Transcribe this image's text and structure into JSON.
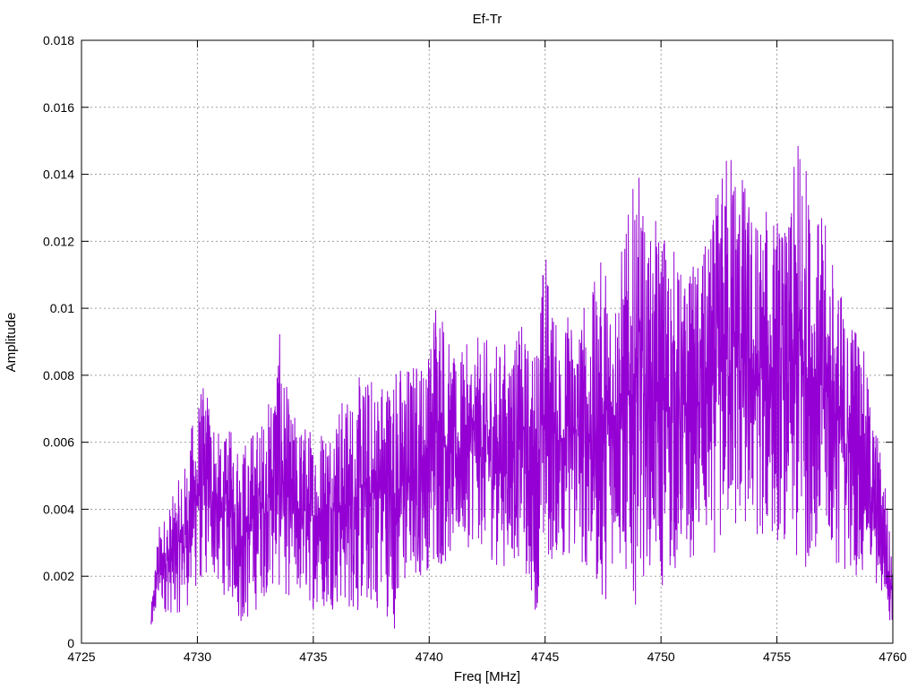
{
  "chart_data": {
    "type": "line",
    "title": "Ef-Tr",
    "xlabel": "Freq [MHz]",
    "ylabel": "Amplitude",
    "xlim": [
      4725,
      4760
    ],
    "ylim": [
      0,
      0.018
    ],
    "x_ticks": [
      4725,
      4730,
      4735,
      4740,
      4745,
      4750,
      4755,
      4760
    ],
    "x_tick_labels": [
      "4725",
      "4730",
      "4735",
      "4740",
      "4745",
      "4750",
      "4755",
      "4760"
    ],
    "y_ticks": [
      0,
      0.002,
      0.004,
      0.006,
      0.008,
      0.01,
      0.012,
      0.014,
      0.016,
      0.018
    ],
    "y_tick_labels": [
      "0",
      "0.002",
      "0.004",
      "0.006",
      "0.008",
      "0.01",
      "0.012",
      "0.014",
      "0.016",
      "0.018"
    ],
    "grid": true,
    "legend": "none",
    "series": [
      {
        "color": "#9400d3",
        "x_start": 4728,
        "x_end": 4760,
        "note_values": "representative envelope samples of a dense noisy spectrum",
        "envelope_x": [
          4728,
          4728.3,
          4729,
          4729.5,
          4730,
          4730.5,
          4731,
          4731.5,
          4732,
          4733,
          4733.5,
          4734,
          4735,
          4736,
          4737,
          4738,
          4738.5,
          4739,
          4740,
          4740.3,
          4741,
          4742,
          4743,
          4744,
          4744.5,
          4745,
          4745.5,
          4746,
          4747,
          4747.5,
          4748,
          4749,
          4749.4,
          4750,
          4751,
          4752,
          4753,
          4753.2,
          4754,
          4755,
          4755.5,
          4756,
          4756.5,
          4757,
          4758,
          4758.5,
          4759,
          4759.6,
          4760
        ],
        "envelope_max": [
          0.001,
          0.0035,
          0.0045,
          0.0055,
          0.0076,
          0.0078,
          0.006,
          0.0065,
          0.0062,
          0.007,
          0.0095,
          0.007,
          0.0065,
          0.0072,
          0.008,
          0.0082,
          0.0085,
          0.0085,
          0.0088,
          0.0114,
          0.0085,
          0.0092,
          0.009,
          0.0095,
          0.0088,
          0.0121,
          0.0095,
          0.01,
          0.0105,
          0.0118,
          0.011,
          0.0143,
          0.012,
          0.013,
          0.011,
          0.012,
          0.0156,
          0.015,
          0.013,
          0.013,
          0.0125,
          0.0161,
          0.013,
          0.0128,
          0.01,
          0.01,
          0.0075,
          0.0055,
          0.0025
        ],
        "envelope_min": [
          0.0002,
          0.001,
          0.0008,
          0.001,
          0.0015,
          0.002,
          0.0015,
          0.0012,
          0.0003,
          0.0015,
          0.0015,
          0.0013,
          0.001,
          0.001,
          0.0008,
          0.001,
          0.0004,
          0.0015,
          0.0022,
          0.002,
          0.0025,
          0.003,
          0.0022,
          0.0025,
          0.0007,
          0.002,
          0.0025,
          0.0025,
          0.002,
          0.0009,
          0.0025,
          0.001,
          0.0025,
          0.0014,
          0.0025,
          0.0025,
          0.003,
          0.003,
          0.003,
          0.003,
          0.003,
          0.0011,
          0.003,
          0.0025,
          0.002,
          0.002,
          0.002,
          0.001,
          0.0005
        ]
      }
    ]
  }
}
